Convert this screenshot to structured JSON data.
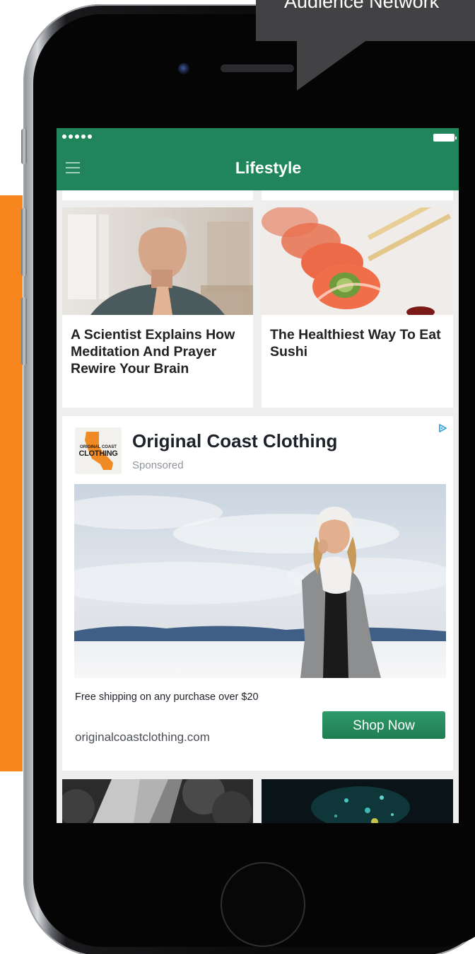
{
  "callout": {
    "text": "Audience Network"
  },
  "status_bar": {
    "signal_icon": "signal-dots-icon",
    "battery_icon": "battery-icon"
  },
  "nav": {
    "menu_icon": "hamburger-menu-icon",
    "title": "Lifestyle",
    "color": "#21855b"
  },
  "articles": [
    {
      "title": "A Scientist Explains How Meditation And Prayer Rewire Your Brain"
    },
    {
      "title": "The Healthiest Way To Eat Sushi"
    }
  ],
  "ad": {
    "logo_text_line1": "ORIGINAL COAST",
    "logo_text_line2": "CLOTHING",
    "advertiser": "Original Coast Clothing",
    "sponsored_label": "Sponsored",
    "body": "Free shipping on any purchase over $20",
    "url": "originalcoastclothing.com",
    "cta_label": "Shop Now",
    "cta_color": "#21855b",
    "adchoices_icon": "adchoices-icon"
  },
  "colors": {
    "accent_orange": "#f7861f",
    "callout_bg": "#424244"
  }
}
